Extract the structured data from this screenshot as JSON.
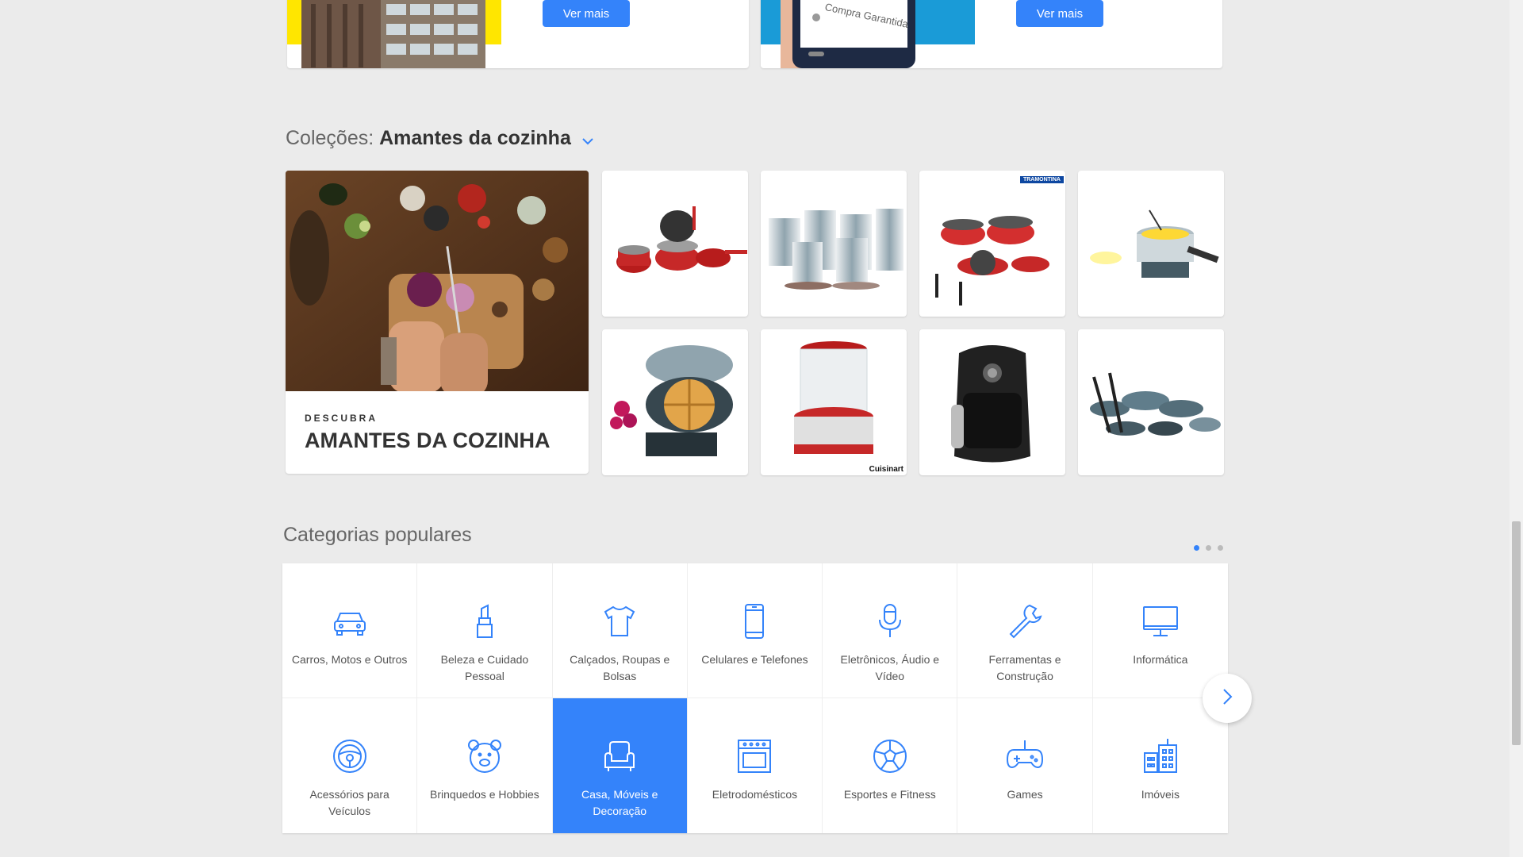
{
  "promos": [
    {
      "button_label": "Ver mais"
    },
    {
      "button_label": "Ver mais",
      "phone_text": "Compra Garantida"
    }
  ],
  "collections": {
    "prefix": "Coleções:",
    "name": "Amantes da cozinha",
    "hero": {
      "eyebrow": "DESCUBRA",
      "title": "AMANTES DA COZINHA"
    },
    "products": [
      {
        "icon": "red-cookware-set",
        "brand": ""
      },
      {
        "icon": "steel-canisters",
        "brand": ""
      },
      {
        "icon": "red-pan-set",
        "brand": "TRAMONTINA"
      },
      {
        "icon": "fondue-pot",
        "brand": ""
      },
      {
        "icon": "waffle-maker",
        "brand": ""
      },
      {
        "icon": "popcorn-maker",
        "brand": "Cuisinart"
      },
      {
        "icon": "air-fryer",
        "brand": ""
      },
      {
        "icon": "grey-cookware-set",
        "brand": ""
      }
    ]
  },
  "categories": {
    "title": "Categorias populares",
    "accent": "#3483fa",
    "items": [
      {
        "label": "Carros, Motos e Outros",
        "icon": "car-icon"
      },
      {
        "label": "Beleza e Cuidado Pessoal",
        "icon": "lipstick-icon"
      },
      {
        "label": "Calçados, Roupas e Bolsas",
        "icon": "tshirt-icon"
      },
      {
        "label": "Celulares e Telefones",
        "icon": "phone-icon"
      },
      {
        "label": "Eletrônicos, Áudio e Vídeo",
        "icon": "microphone-icon"
      },
      {
        "label": "Ferramentas e Construção",
        "icon": "wrench-icon"
      },
      {
        "label": "Informática",
        "icon": "monitor-icon"
      },
      {
        "label": "Acessórios para Veículos",
        "icon": "steering-wheel-icon"
      },
      {
        "label": "Brinquedos e Hobbies",
        "icon": "bear-icon"
      },
      {
        "label": "Casa, Móveis e Decoração",
        "icon": "armchair-icon",
        "selected": true
      },
      {
        "label": "Eletrodomésticos",
        "icon": "oven-icon"
      },
      {
        "label": "Esportes e Fitness",
        "icon": "soccer-ball-icon"
      },
      {
        "label": "Games",
        "icon": "gamepad-icon"
      },
      {
        "label": "Imóveis",
        "icon": "buildings-icon"
      }
    ]
  }
}
